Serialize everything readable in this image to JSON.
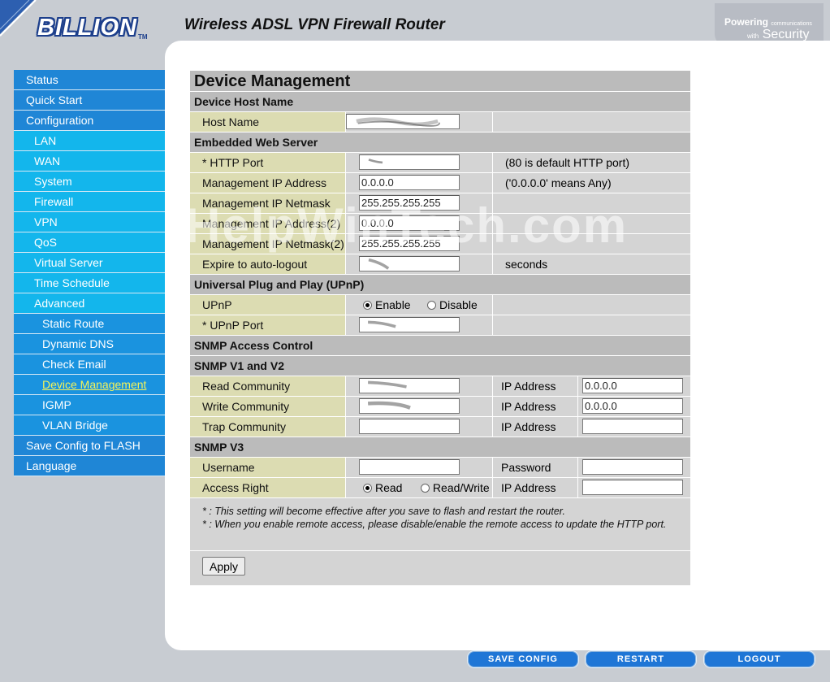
{
  "header": {
    "brand": "BILLION",
    "trademark": "TM",
    "product_title": "Wireless ADSL VPN Firewall Router",
    "tagline_word1": "Powering",
    "tagline_small1": "communications",
    "tagline_small2": "with",
    "tagline_word2": "Security"
  },
  "sidebar": {
    "items": [
      {
        "label": "Status"
      },
      {
        "label": "Quick Start"
      },
      {
        "label": "Configuration"
      },
      {
        "label": "LAN"
      },
      {
        "label": "WAN"
      },
      {
        "label": "System"
      },
      {
        "label": "Firewall"
      },
      {
        "label": "VPN"
      },
      {
        "label": "QoS"
      },
      {
        "label": "Virtual Server"
      },
      {
        "label": "Time Schedule"
      },
      {
        "label": "Advanced"
      },
      {
        "label": "Static Route"
      },
      {
        "label": "Dynamic DNS"
      },
      {
        "label": "Check Email"
      },
      {
        "label": "Device Management"
      },
      {
        "label": "IGMP"
      },
      {
        "label": "VLAN Bridge"
      },
      {
        "label": "Save Config to FLASH"
      },
      {
        "label": "Language"
      }
    ],
    "active": "Device Management"
  },
  "main": {
    "page_title": "Device Management",
    "host_section": "Device Host Name",
    "host_name_label": "Host Name",
    "web_section": "Embedded Web Server",
    "http_port_label": "* HTTP Port",
    "http_port_note": "(80 is default HTTP port)",
    "mgmt_ip_label": "Management IP Address",
    "mgmt_ip_value": "0.0.0.0",
    "mgmt_ip_note": "('0.0.0.0' means Any)",
    "mgmt_mask_label": "Management IP Netmask",
    "mgmt_mask_value": "255.255.255.255",
    "mgmt_ip2_label": "Management IP Address(2)",
    "mgmt_ip2_value": "0.0.0.0",
    "mgmt_mask2_label": "Management IP Netmask(2)",
    "mgmt_mask2_value": "255.255.255.255",
    "expire_label": "Expire to auto-logout",
    "expire_unit": "seconds",
    "upnp_section": "Universal Plug and Play (UPnP)",
    "upnp_label": "UPnP",
    "upnp_enable": "Enable",
    "upnp_disable": "Disable",
    "upnp_selected": "Enable",
    "upnp_port_label": "* UPnP Port",
    "snmp_section": "SNMP Access Control",
    "snmp_v1v2_section": "SNMP V1 and V2",
    "read_community_label": "Read Community",
    "write_community_label": "Write Community",
    "trap_community_label": "Trap Community",
    "ip_address_label": "IP Address",
    "read_ip_value": "0.0.0.0",
    "write_ip_value": "0.0.0.0",
    "trap_ip_value": "",
    "snmp_v3_section": "SNMP V3",
    "username_label": "Username",
    "password_label": "Password",
    "access_right_label": "Access Right",
    "access_read": "Read",
    "access_readwrite": "Read/Write",
    "access_selected": "Read",
    "note1": "* : This setting will become effective after you save to flash and restart the router.",
    "note2": "* : When you enable remote access, please disable/enable the remote access to update the HTTP port.",
    "apply_label": "Apply"
  },
  "footer": {
    "save_config": "SAVE CONFIG",
    "restart": "RESTART",
    "logout": "LOGOUT"
  },
  "watermark": "HelpWinTech.com",
  "colors": {
    "nav_level0": "#1f86d6",
    "nav_level1": "#13b6ec",
    "nav_level2": "#1a93df",
    "label_cell": "#dcdcb2",
    "section_header": "#bbbbbb",
    "active_link": "#f2f25a"
  }
}
